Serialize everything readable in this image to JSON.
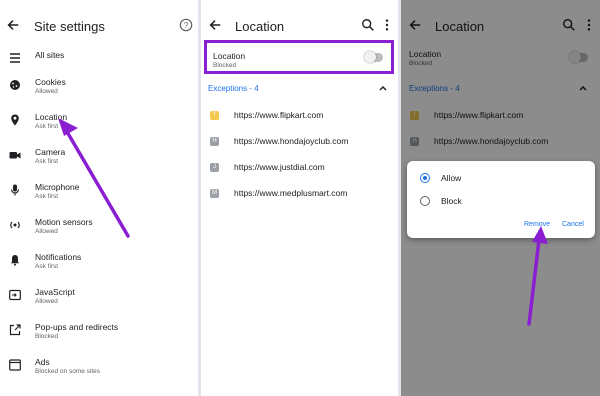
{
  "panel1": {
    "title": "Site settings",
    "items": [
      {
        "label": "All sites",
        "sub": "",
        "icon": "list-icon"
      },
      {
        "label": "Cookies",
        "sub": "Allowed",
        "icon": "cookie-icon"
      },
      {
        "label": "Location",
        "sub": "Ask first",
        "icon": "location-pin-icon"
      },
      {
        "label": "Camera",
        "sub": "Ask first",
        "icon": "camera-icon"
      },
      {
        "label": "Microphone",
        "sub": "Ask first",
        "icon": "microphone-icon"
      },
      {
        "label": "Motion sensors",
        "sub": "Allowed",
        "icon": "motion-sensor-icon"
      },
      {
        "label": "Notifications",
        "sub": "Ask first",
        "icon": "bell-icon"
      },
      {
        "label": "JavaScript",
        "sub": "Allowed",
        "icon": "javascript-icon"
      },
      {
        "label": "Pop-ups and redirects",
        "sub": "Blocked",
        "icon": "popup-icon"
      },
      {
        "label": "Ads",
        "sub": "Blocked on some sites",
        "icon": "ads-icon"
      }
    ]
  },
  "panel2": {
    "title": "Location",
    "setting": {
      "label": "Location",
      "sub": "Blocked"
    },
    "exceptions_label": "Exceptions - 4",
    "sites": [
      {
        "url": "https://www.flipkart.com",
        "fav": "f"
      },
      {
        "url": "https://www.hondajoyclub.com",
        "fav": "H"
      },
      {
        "url": "https://www.justdial.com",
        "fav": "J"
      },
      {
        "url": "https://www.medplusmart.com",
        "fav": "M"
      }
    ]
  },
  "panel3": {
    "title": "Location",
    "setting": {
      "label": "Location",
      "sub": "Blocked"
    },
    "exceptions_label": "Exceptions - 4",
    "sites": [
      {
        "url": "https://www.flipkart.com",
        "fav": "f"
      },
      {
        "url": "https://www.hondajoyclub.com",
        "fav": "H"
      }
    ],
    "dialog": {
      "option_allow": "Allow",
      "option_block": "Block",
      "selected": "Allow",
      "remove_label": "Remove",
      "cancel_label": "Cancel"
    }
  },
  "colors": {
    "accent": "#1a73e8",
    "highlight": "#8a1fd1",
    "arrow": "#8a1fd1"
  }
}
